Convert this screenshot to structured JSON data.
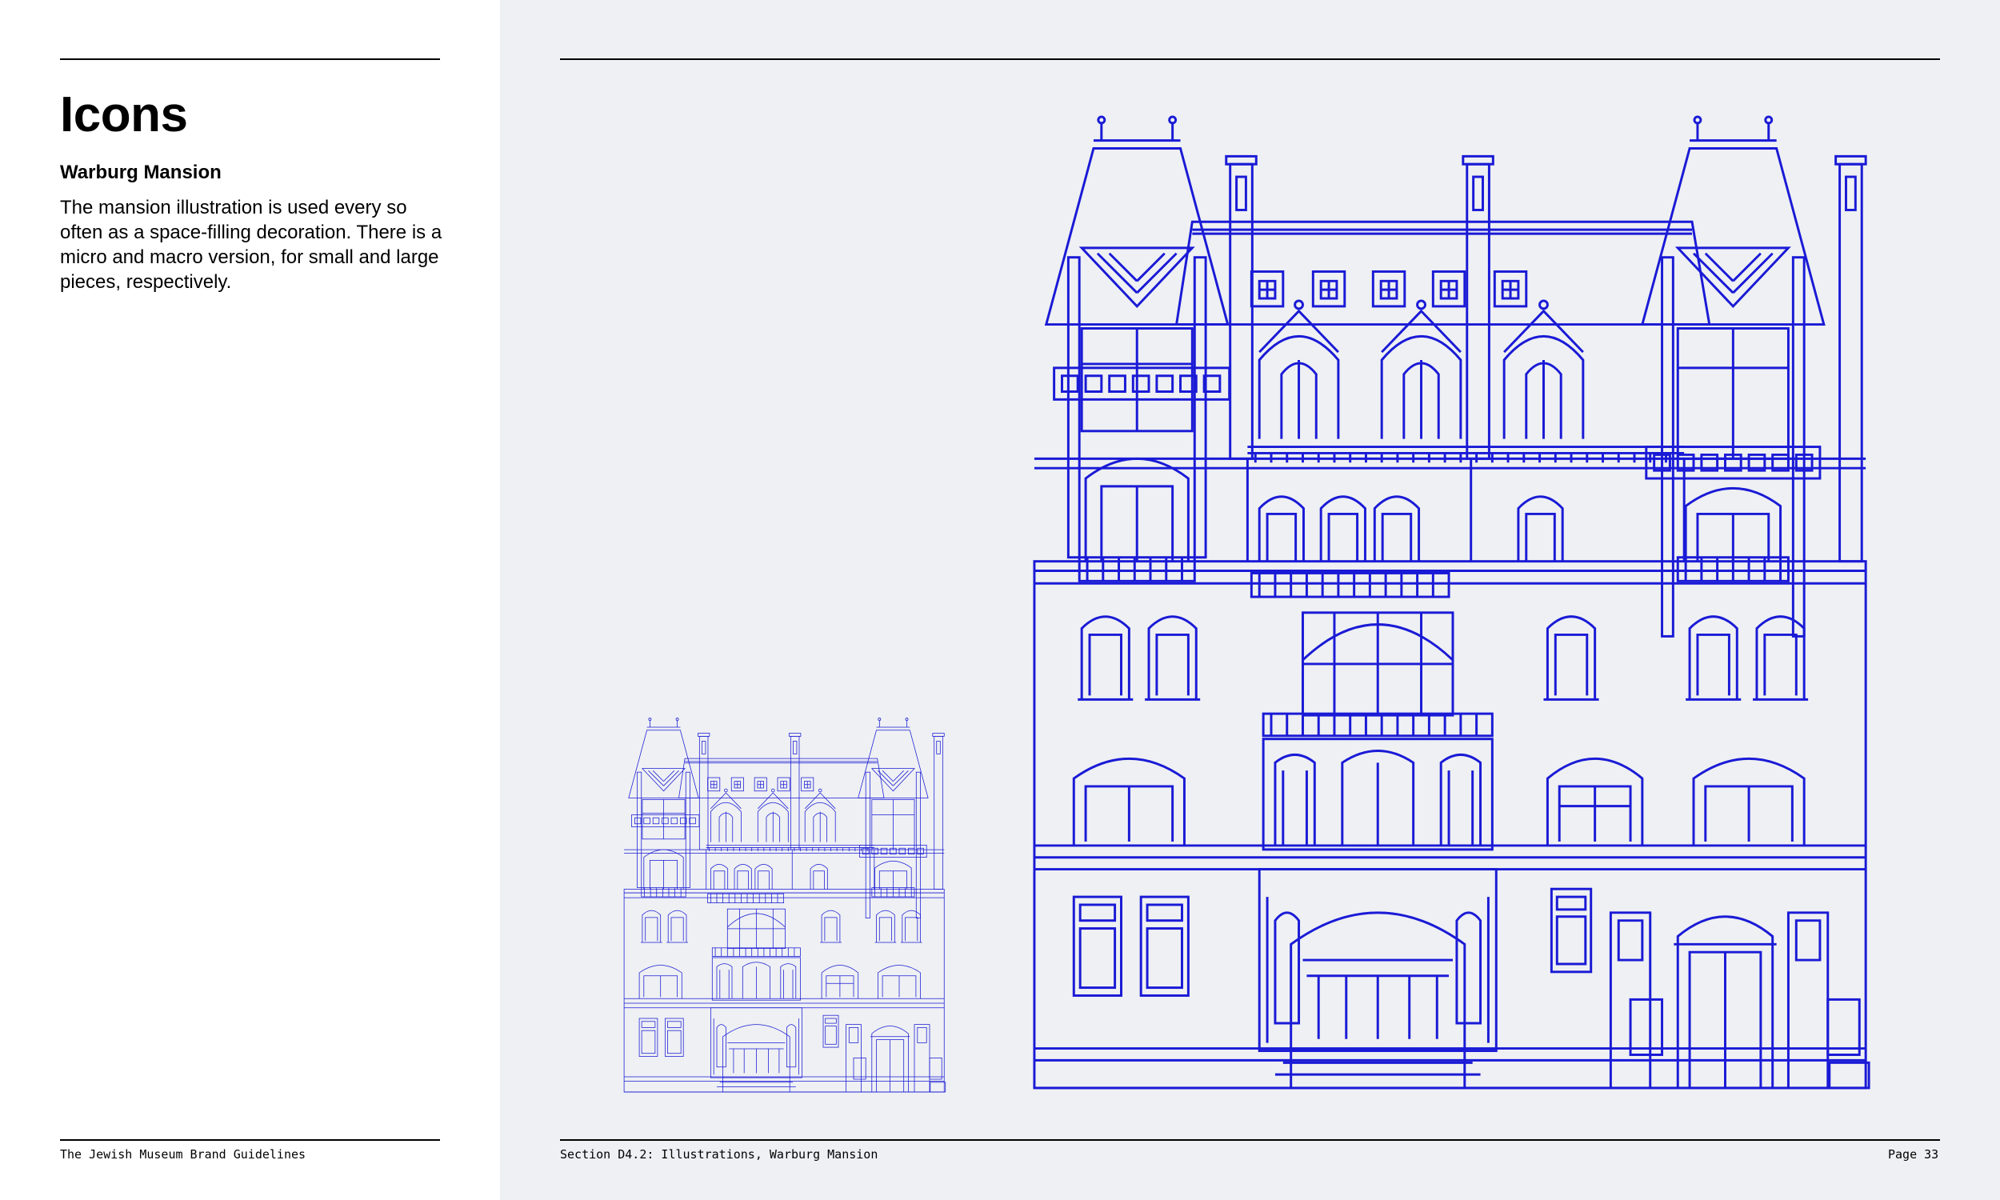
{
  "page": {
    "title": "Icons",
    "subtitle": "Warburg Mansion",
    "description": "The mansion illustration is used every so often as a space-filling decoration. There is a micro and macro version, for small and large pieces, respectively."
  },
  "footer": {
    "left": "The Jewish Museum Brand Guidelines",
    "section": "Section D4.2: Illustrations, Warburg Mansion",
    "page_number": "Page 33"
  },
  "colors": {
    "illustration_stroke": "#1a1ad6",
    "panel_background": "#eef0f3",
    "text": "#000000"
  }
}
